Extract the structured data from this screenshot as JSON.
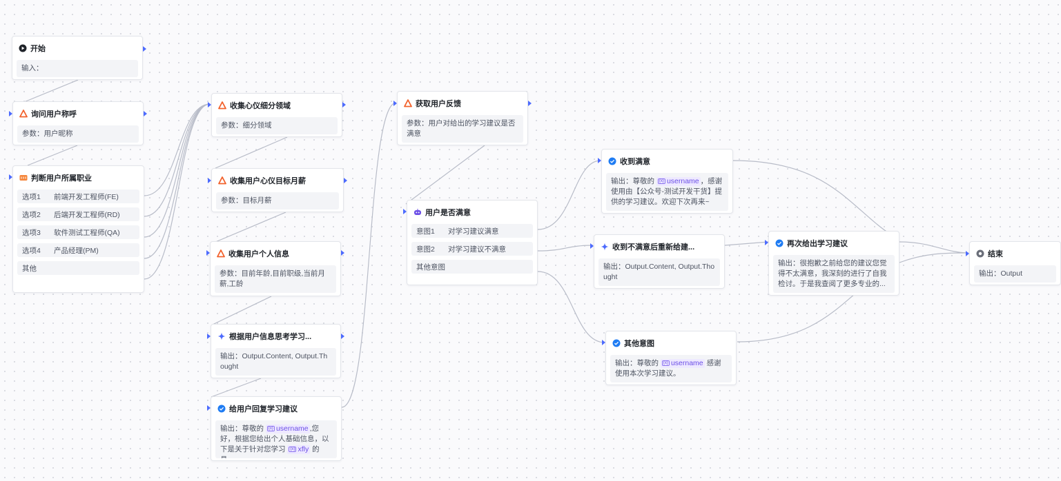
{
  "nodes": {
    "start": {
      "title": "开始",
      "label": "输入：",
      "value": ""
    },
    "ask_name": {
      "title": "询问用户称呼",
      "label": "参数：",
      "value": "用户昵称"
    },
    "judge_job": {
      "title": "判断用户所属职业",
      "options": [
        {
          "label": "选项1",
          "value": "前端开发工程师(FE)"
        },
        {
          "label": "选项2",
          "value": "后端开发工程师(RD)"
        },
        {
          "label": "选项3",
          "value": "软件测试工程师(QA)"
        },
        {
          "label": "选项4",
          "value": "产品经理(PM)"
        },
        {
          "label": "其他",
          "value": ""
        }
      ]
    },
    "collect_field": {
      "title": "收集心仪细分领域",
      "label": "参数：",
      "value": "细分领域"
    },
    "collect_salary": {
      "title": "收集用户心仪目标月薪",
      "label": "参数：",
      "value": "目标月薪"
    },
    "collect_personal": {
      "title": "收集用户个人信息",
      "label": "参数：",
      "value": "目前年龄,目前职级,当前月薪,工龄"
    },
    "think_advice": {
      "title": "根据用户信息思考学习...",
      "label": "输出：",
      "value": "Output.Content, Output.Thought"
    },
    "reply_advice": {
      "title": "给用户回复学习建议",
      "label": "输出：",
      "pre": "尊敬的",
      "var1": "username",
      "mid": ",您好，根据您给出个人基础信息，以下是关于针对您学习",
      "var2": "xfly",
      "post": "的具..."
    },
    "get_feedback": {
      "title": "获取用户反馈",
      "label": "参数：",
      "value": "用户对给出的学习建议是否满意"
    },
    "satisfied_check": {
      "title": "用户是否满意",
      "intents": [
        {
          "label": "意图1",
          "value": "对学习建议满意"
        },
        {
          "label": "意图2",
          "value": "对学习建议不满意"
        },
        {
          "label": "其他意图",
          "value": ""
        }
      ]
    },
    "received_satisfied": {
      "title": "收到满意",
      "label": "输出：",
      "pre": "尊敬的",
      "var1": "username",
      "post": "，感谢使用由【公众号-测试开发干货】提供的学习建议。欢迎下次再来~"
    },
    "regen_advice": {
      "title": "收到不满意后重新给建...",
      "label": "输出：",
      "value": "Output.Content, Output.Thought"
    },
    "other_intent": {
      "title": "其他意图",
      "label": "输出：",
      "pre": "尊敬的",
      "var1": "username",
      "post": "感谢使用本次学习建议。"
    },
    "again_advice": {
      "title": "再次给出学习建议",
      "label": "输出：",
      "value": "很抱歉之前给您的建议您觉得不太满意，我深刻的进行了自我检讨。于是我查阅了更多专业的..."
    },
    "end": {
      "title": "结束",
      "label": "输出：",
      "value": "Output"
    }
  },
  "icons": {
    "start": "play-circle-icon",
    "question": "triangle-question-icon",
    "judge": "branch-selector-icon",
    "llm": "sparkle-icon",
    "message": "check-badge-icon",
    "intent": "robot-intent-icon",
    "end": "stop-circle-icon"
  },
  "colors": {
    "accent": "#4d6bfe",
    "question_orange": "#f2612b",
    "judge_orange": "#f5853a",
    "llm_blue": "#4d6bfe",
    "message_blue": "#1f7cf3",
    "intent_purple": "#6b4ee6",
    "edge": "#b8bcc8"
  }
}
